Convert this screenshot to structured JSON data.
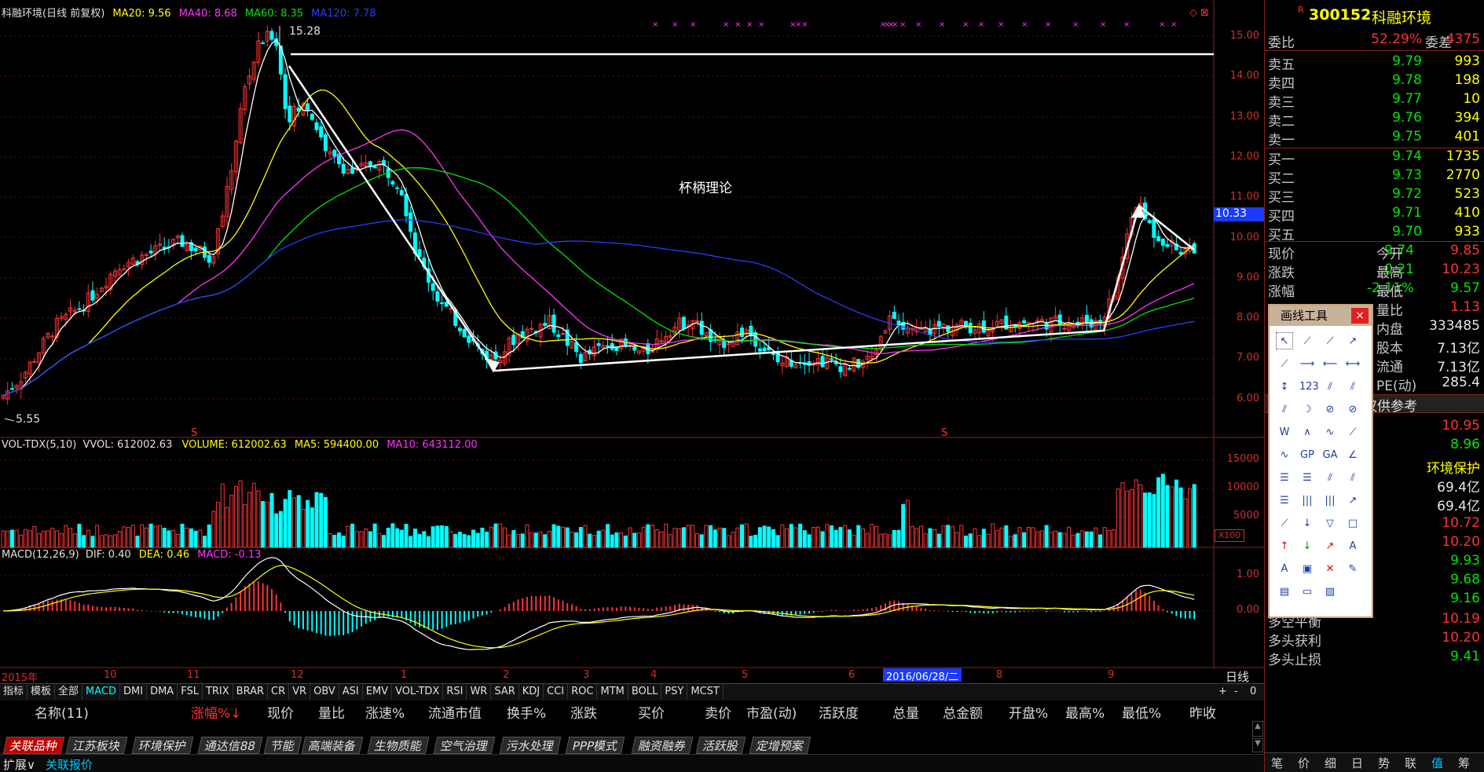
{
  "chart_title": {
    "name": "科融环境(日线 前复权)",
    "ma20": "MA20: 9.56",
    "ma40": "MA40: 8.68",
    "ma60": "MA60: 8.35",
    "ma120": "MA120: 7.78"
  },
  "annotations": {
    "high_label": "15.28",
    "low_label": "5.55",
    "pattern_label": "杯柄理论",
    "current_price_tag": "10.33",
    "date_marker": "2016/06/28/二"
  },
  "price_axis": [
    "15.00",
    "14.00",
    "13.00",
    "12.00",
    "11.00",
    "10.00",
    "9.00",
    "8.00",
    "7.00",
    "6.00"
  ],
  "volume_title": {
    "name": "VOL-TDX(5,10)",
    "vvol": "VVOL: 612002.63",
    "volume": "VOLUME: 612002.63",
    "ma5": "MA5: 594400.00",
    "ma10": "MA10: 643112.00"
  },
  "volume_axis": [
    "15000",
    "10000",
    "5000",
    "X100"
  ],
  "macd_title": {
    "name": "MACD(12,26,9)",
    "dif": "DIF: 0.40",
    "dea": "DEA: 0.46",
    "macd": "MACD: -0.13"
  },
  "macd_axis": [
    "1.00",
    "0.00"
  ],
  "time_axis": [
    "2015年",
    "10",
    "11",
    "12",
    "1",
    "2",
    "3",
    "4",
    "5",
    "6",
    "8",
    "9"
  ],
  "time_axis_right": "日线",
  "indicator_tabs": [
    "指标",
    "模板",
    "全部",
    "MACD",
    "DMI",
    "DMA",
    "FSL",
    "TRIX",
    "BRAR",
    "CR",
    "VR",
    "OBV",
    "ASI",
    "EMV",
    "VOL-TDX",
    "RSI",
    "WR",
    "SAR",
    "KDJ",
    "CCI",
    "ROC",
    "MTM",
    "BOLL",
    "PSY",
    "MCST"
  ],
  "table_controls": [
    "+",
    "-",
    "0"
  ],
  "table_headers": [
    "名称(11)",
    "涨幅%↓",
    "现价",
    "量比",
    "涨速%",
    "流通市值",
    "换手%",
    "涨跌",
    "买价",
    "卖价",
    "市盈(动)",
    "活跃度",
    "总量",
    "总金额",
    "开盘%",
    "最高%",
    "最低%",
    "昨收"
  ],
  "sector_tabs": [
    "关联品种",
    "江苏板块",
    "环境保护",
    "通达信88",
    "节能",
    "高端装备",
    "生物质能",
    "空气治理",
    "污水处理",
    "PPP模式",
    "融资融券",
    "活跃股",
    "定增预案"
  ],
  "bottom_left": {
    "expand": "扩展∨",
    "related": "关联报价"
  },
  "right_panel": {
    "code": "300152",
    "name": "科融环境",
    "r_mark": "R",
    "weibi_label": "委比",
    "weibi_value": "52.29%",
    "weicha_label": "委差",
    "weicha_value": "4375",
    "sell": [
      {
        "label": "卖五",
        "price": "9.79",
        "vol": "993"
      },
      {
        "label": "卖四",
        "price": "9.78",
        "vol": "198"
      },
      {
        "label": "卖三",
        "price": "9.77",
        "vol": "10"
      },
      {
        "label": "卖二",
        "price": "9.76",
        "vol": "394"
      },
      {
        "label": "卖一",
        "price": "9.75",
        "vol": "401"
      }
    ],
    "buy": [
      {
        "label": "买一",
        "price": "9.74",
        "vol": "1735"
      },
      {
        "label": "买二",
        "price": "9.73",
        "vol": "2770"
      },
      {
        "label": "买三",
        "price": "9.72",
        "vol": "523"
      },
      {
        "label": "买四",
        "price": "9.71",
        "vol": "410"
      },
      {
        "label": "买五",
        "price": "9.70",
        "vol": "933"
      }
    ],
    "quote": [
      {
        "label": "现价",
        "value": "9.74",
        "label2": "今开",
        "value2": "9.85"
      },
      {
        "label": "涨跌",
        "value": "-0.21",
        "label2": "最高",
        "value2": "10.23"
      },
      {
        "label": "涨幅",
        "value": "-2.11%",
        "label2": "最低",
        "value2": "9.57"
      }
    ],
    "extra": [
      {
        "label": "量比",
        "value": "1.13"
      },
      {
        "label": "内盘",
        "value": "333485"
      },
      {
        "label": "股本",
        "value": "7.13亿"
      },
      {
        "label": "流通",
        "value": "7.13亿"
      },
      {
        "label": "PE(动)",
        "value": "285.4"
      }
    ],
    "ref_label": "仅供参考",
    "ref_values": [
      "10.95",
      "8.96"
    ],
    "industry": "环境保护",
    "industry_values": [
      "69.4亿",
      "69.4亿"
    ],
    "more_values": [
      "10.72",
      "10.20",
      "9.93",
      "9.68",
      "9.16"
    ],
    "strategy": [
      {
        "label": "多空平衡",
        "value": "10.19"
      },
      {
        "label": "多头获利",
        "value": "10.20"
      },
      {
        "label": "多头止损",
        "value": "9.41"
      }
    ],
    "bottom_tabs": [
      "笔",
      "价",
      "细",
      "日",
      "势",
      "联",
      "值",
      "筹"
    ]
  },
  "draw_toolbox": {
    "title": "画线工具",
    "close": "×",
    "tools": [
      "↖",
      "⟋",
      "⟋",
      "↗",
      "⟋",
      "⟶",
      "⟵",
      "⟷",
      "↕",
      "123",
      "⫽",
      "⫽",
      "⫽",
      "☽",
      "⊘",
      "⊘",
      "W",
      "∧",
      "∿",
      "⟋",
      "∿",
      "GP",
      "GA",
      "∠",
      "☰",
      "☰",
      "⫽",
      "⫽",
      "☰",
      "|||",
      "|||",
      "↗",
      "⟋",
      "↓",
      "▽",
      "□",
      "↑",
      "↓",
      "↗",
      "A",
      "A",
      "▣",
      "✕",
      "✎",
      "▤",
      "▭",
      "▨"
    ]
  },
  "colors": {
    "up": "#ff3232",
    "down": "#00ffff",
    "ma5_line": "#ffffff",
    "ma20": "#ffff00",
    "ma40": "#ff33ff",
    "ma60": "#00e600",
    "ma120": "#2b3bff"
  }
}
